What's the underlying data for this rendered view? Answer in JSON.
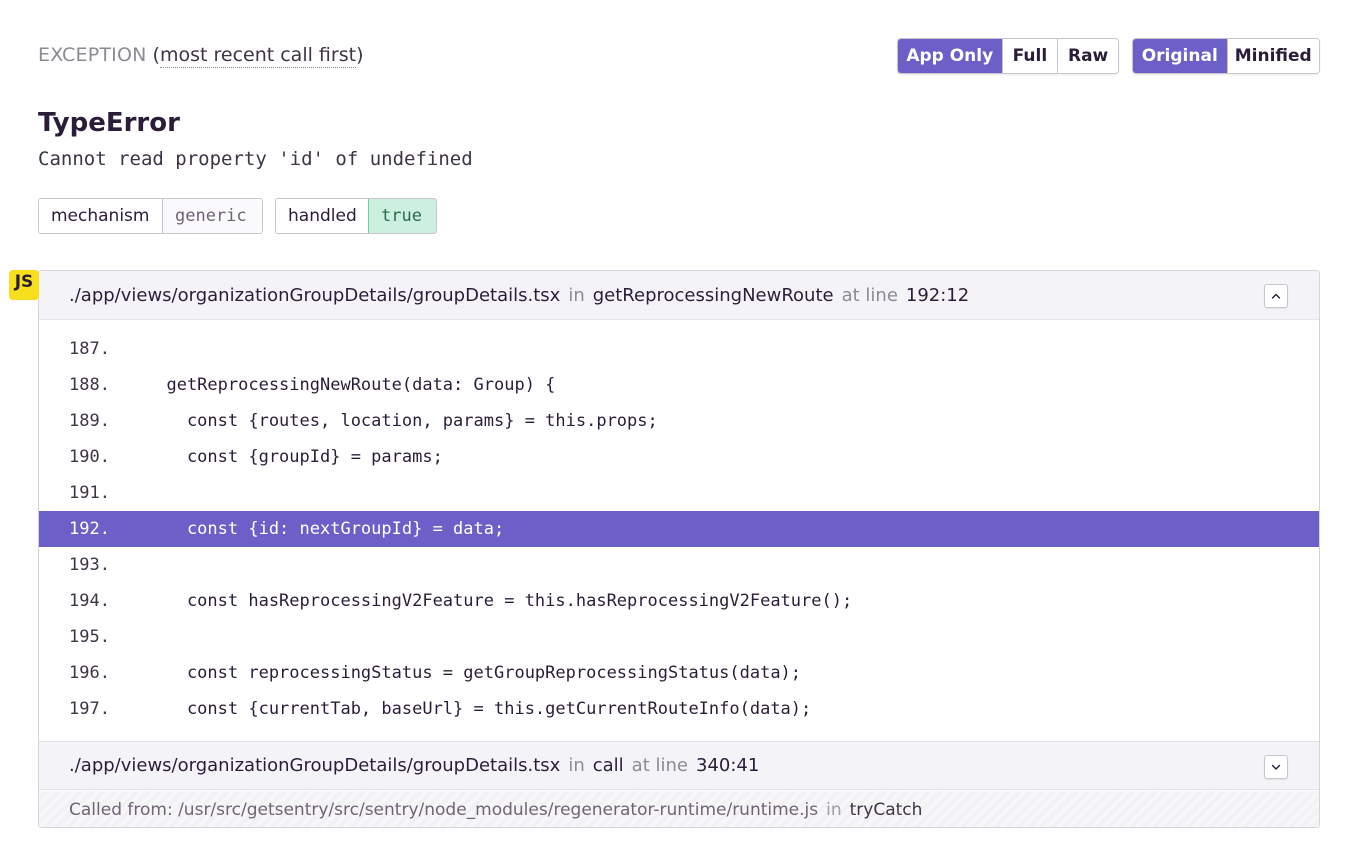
{
  "header": {
    "title": "EXCEPTION",
    "subtitle_open": "(",
    "subtitle_text": "most recent call first",
    "subtitle_close": ")"
  },
  "view_toggle": {
    "app_only": "App Only",
    "full": "Full",
    "raw": "Raw",
    "active": "App Only"
  },
  "format_toggle": {
    "original": "Original",
    "minified": "Minified",
    "active": "Original"
  },
  "error": {
    "type": "TypeError",
    "message": "Cannot read property 'id' of undefined"
  },
  "tags": [
    {
      "key": "mechanism",
      "value": "generic"
    },
    {
      "key": "handled",
      "value": "true"
    }
  ],
  "platform_badge": "JS",
  "frames": [
    {
      "file": "./app/views/organizationGroupDetails/groupDetails.tsx",
      "in_label": "in",
      "function": "getReprocessingNewRoute",
      "at_label": "at line",
      "location": "192:12",
      "expanded": true,
      "toggle_icon": "chevron-up-icon",
      "code": [
        {
          "num": "187.",
          "src": ""
        },
        {
          "num": "188.",
          "src": "  getReprocessingNewRoute(data: Group) {"
        },
        {
          "num": "189.",
          "src": "    const {routes, location, params} = this.props;"
        },
        {
          "num": "190.",
          "src": "    const {groupId} = params;"
        },
        {
          "num": "191.",
          "src": ""
        },
        {
          "num": "192.",
          "src": "    const {id: nextGroupId} = data;"
        },
        {
          "num": "193.",
          "src": ""
        },
        {
          "num": "194.",
          "src": "    const hasReprocessingV2Feature = this.hasReprocessingV2Feature();"
        },
        {
          "num": "195.",
          "src": ""
        },
        {
          "num": "196.",
          "src": "    const reprocessingStatus = getGroupReprocessingStatus(data);"
        },
        {
          "num": "197.",
          "src": "    const {currentTab, baseUrl} = this.getCurrentRouteInfo(data);"
        }
      ],
      "highlight_line": "192."
    },
    {
      "file": "./app/views/organizationGroupDetails/groupDetails.tsx",
      "in_label": "in",
      "function": "call",
      "at_label": "at line",
      "location": "340:41",
      "expanded": false,
      "toggle_icon": "chevron-down-icon"
    }
  ],
  "called_from": {
    "label": "Called from: /usr/src/getsentry/src/sentry/node_modules/regenerator-runtime/runtime.js",
    "in_label": "in",
    "function": "tryCatch"
  },
  "colors": {
    "accent": "#6c5fc7",
    "js_badge": "#f7df1e",
    "true_tag": "#cdefe0"
  }
}
